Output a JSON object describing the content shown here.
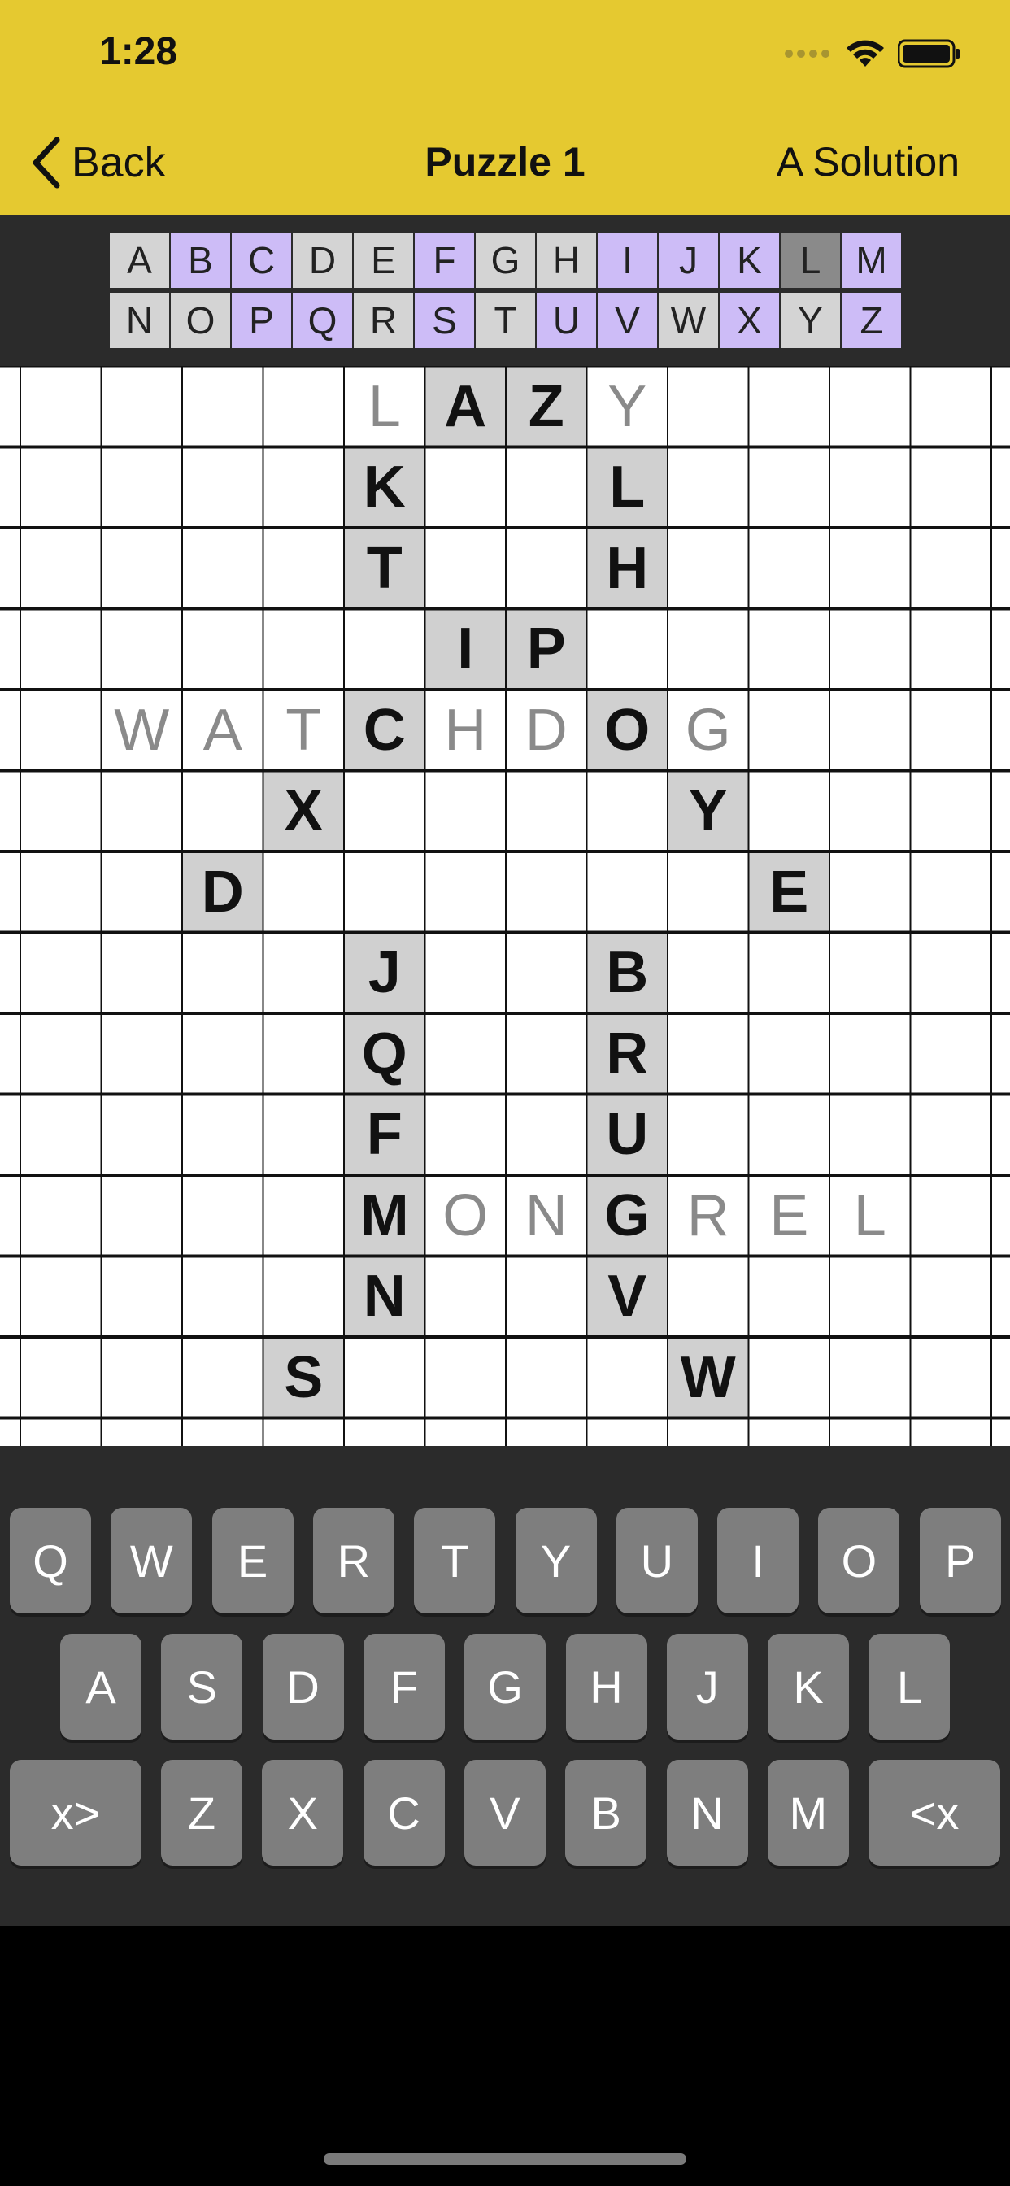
{
  "status": {
    "time": "1:28"
  },
  "nav": {
    "back_label": "Back",
    "title": "Puzzle 1",
    "solution_label": "A Solution"
  },
  "colors": {
    "header": "#e5c930",
    "used_letter": "#cdbcf7",
    "given_cell": "#d0d0d0",
    "solve_letter": "#8a8a8a",
    "key": "#7e7e7e"
  },
  "alphabet": {
    "row1": [
      {
        "l": "A",
        "s": "unused"
      },
      {
        "l": "B",
        "s": "used"
      },
      {
        "l": "C",
        "s": "used"
      },
      {
        "l": "D",
        "s": "unused"
      },
      {
        "l": "E",
        "s": "unused"
      },
      {
        "l": "F",
        "s": "used"
      },
      {
        "l": "G",
        "s": "unused"
      },
      {
        "l": "H",
        "s": "unused"
      },
      {
        "l": "I",
        "s": "used"
      },
      {
        "l": "J",
        "s": "used"
      },
      {
        "l": "K",
        "s": "used"
      },
      {
        "l": "L",
        "s": "selected"
      },
      {
        "l": "M",
        "s": "used"
      }
    ],
    "row2": [
      {
        "l": "N",
        "s": "unused"
      },
      {
        "l": "O",
        "s": "unused"
      },
      {
        "l": "P",
        "s": "used"
      },
      {
        "l": "Q",
        "s": "used"
      },
      {
        "l": "R",
        "s": "unused"
      },
      {
        "l": "S",
        "s": "used"
      },
      {
        "l": "T",
        "s": "unused"
      },
      {
        "l": "U",
        "s": "used"
      },
      {
        "l": "V",
        "s": "used"
      },
      {
        "l": "W",
        "s": "unused"
      },
      {
        "l": "X",
        "s": "used"
      },
      {
        "l": "Y",
        "s": "unused"
      },
      {
        "l": "Z",
        "s": "used"
      }
    ]
  },
  "grid": {
    "cols": 13,
    "rows": 13,
    "cells": [
      {
        "r": 0,
        "c": 4,
        "t": "L",
        "k": "solve"
      },
      {
        "r": 0,
        "c": 5,
        "t": "A",
        "k": "given"
      },
      {
        "r": 0,
        "c": 6,
        "t": "Z",
        "k": "given"
      },
      {
        "r": 0,
        "c": 7,
        "t": "Y",
        "k": "solve"
      },
      {
        "r": 1,
        "c": 4,
        "t": "K",
        "k": "given"
      },
      {
        "r": 1,
        "c": 7,
        "t": "L",
        "k": "given"
      },
      {
        "r": 2,
        "c": 4,
        "t": "T",
        "k": "given"
      },
      {
        "r": 2,
        "c": 7,
        "t": "H",
        "k": "given"
      },
      {
        "r": 3,
        "c": 5,
        "t": "I",
        "k": "given"
      },
      {
        "r": 3,
        "c": 6,
        "t": "P",
        "k": "given"
      },
      {
        "r": 4,
        "c": 1,
        "t": "W",
        "k": "solve"
      },
      {
        "r": 4,
        "c": 2,
        "t": "A",
        "k": "solve"
      },
      {
        "r": 4,
        "c": 3,
        "t": "T",
        "k": "solve"
      },
      {
        "r": 4,
        "c": 4,
        "t": "C",
        "k": "given"
      },
      {
        "r": 4,
        "c": 5,
        "t": "H",
        "k": "solve"
      },
      {
        "r": 4,
        "c": 6,
        "t": "D",
        "k": "solve"
      },
      {
        "r": 4,
        "c": 7,
        "t": "O",
        "k": "given"
      },
      {
        "r": 4,
        "c": 8,
        "t": "G",
        "k": "solve"
      },
      {
        "r": 5,
        "c": 3,
        "t": "X",
        "k": "given"
      },
      {
        "r": 5,
        "c": 8,
        "t": "Y",
        "k": "given"
      },
      {
        "r": 6,
        "c": 2,
        "t": "D",
        "k": "given"
      },
      {
        "r": 6,
        "c": 9,
        "t": "E",
        "k": "given"
      },
      {
        "r": 7,
        "c": 4,
        "t": "J",
        "k": "given"
      },
      {
        "r": 7,
        "c": 7,
        "t": "B",
        "k": "given"
      },
      {
        "r": 8,
        "c": 4,
        "t": "Q",
        "k": "given"
      },
      {
        "r": 8,
        "c": 7,
        "t": "R",
        "k": "given"
      },
      {
        "r": 9,
        "c": 4,
        "t": "F",
        "k": "given"
      },
      {
        "r": 9,
        "c": 7,
        "t": "U",
        "k": "given"
      },
      {
        "r": 10,
        "c": 4,
        "t": "M",
        "k": "given"
      },
      {
        "r": 10,
        "c": 5,
        "t": "O",
        "k": "solve"
      },
      {
        "r": 10,
        "c": 6,
        "t": "N",
        "k": "solve"
      },
      {
        "r": 10,
        "c": 7,
        "t": "G",
        "k": "given"
      },
      {
        "r": 10,
        "c": 8,
        "t": "R",
        "k": "solve"
      },
      {
        "r": 10,
        "c": 9,
        "t": "E",
        "k": "solve"
      },
      {
        "r": 10,
        "c": 10,
        "t": "L",
        "k": "solve"
      },
      {
        "r": 11,
        "c": 4,
        "t": "N",
        "k": "given"
      },
      {
        "r": 11,
        "c": 7,
        "t": "V",
        "k": "given"
      },
      {
        "r": 12,
        "c": 3,
        "t": "S",
        "k": "given"
      },
      {
        "r": 12,
        "c": 8,
        "t": "W",
        "k": "given"
      }
    ]
  },
  "keyboard": {
    "row1": [
      "Q",
      "W",
      "E",
      "R",
      "T",
      "Y",
      "U",
      "I",
      "O",
      "P"
    ],
    "row2": [
      "A",
      "S",
      "D",
      "F",
      "G",
      "H",
      "J",
      "K",
      "L"
    ],
    "row3": [
      "Z",
      "X",
      "C",
      "V",
      "B",
      "N",
      "M"
    ],
    "left_special": "x>",
    "right_special": "<x"
  }
}
